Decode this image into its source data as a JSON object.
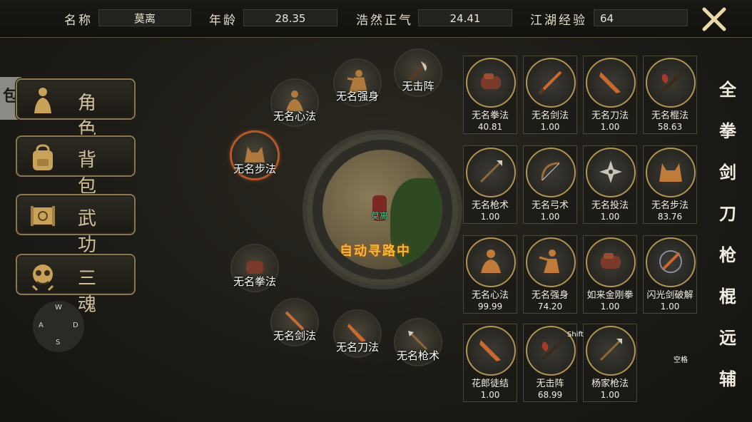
{
  "header": {
    "name_label": "名称",
    "name_value": "莫离",
    "age_label": "年龄",
    "age_value": "28.35",
    "righteous_label": "浩然正气",
    "righteous_value": "24.41",
    "exp_label": "江湖经验",
    "exp_value": "64"
  },
  "edge_tab": "包",
  "sidebar": [
    {
      "label": "角色",
      "icon": "character-icon"
    },
    {
      "label": "背包",
      "icon": "backpack-icon"
    },
    {
      "label": "武功",
      "icon": "scroll-icon"
    },
    {
      "label": "三魂",
      "icon": "soul-mask-icon"
    }
  ],
  "dpad": {
    "up": "W",
    "left": "A",
    "right": "D",
    "down": "S"
  },
  "orbit": [
    {
      "label": "无名心法"
    },
    {
      "label": "无名强身"
    },
    {
      "label": "无击阵"
    },
    {
      "label": "无名步法"
    },
    {
      "label": "无名拳法"
    },
    {
      "label": "无名剑法"
    },
    {
      "label": "无名刀法"
    },
    {
      "label": "无名枪术"
    }
  ],
  "center": {
    "name": "莫离",
    "status": "自动寻路中"
  },
  "skills": [
    {
      "name": "无名拳法",
      "value": "40.81",
      "icon": "gauntlet-icon"
    },
    {
      "name": "无名剑法",
      "value": "1.00",
      "icon": "sword-icon"
    },
    {
      "name": "无名刀法",
      "value": "1.00",
      "icon": "blade-icon"
    },
    {
      "name": "无名棍法",
      "value": "58.63",
      "icon": "axe-staff-icon"
    },
    {
      "name": "无名枪术",
      "value": "1.00",
      "icon": "spear-icon"
    },
    {
      "name": "无名弓术",
      "value": "1.00",
      "icon": "bow-icon"
    },
    {
      "name": "无名投法",
      "value": "1.00",
      "icon": "shuriken-icon"
    },
    {
      "name": "无名步法",
      "value": "83.76",
      "icon": "wolf-icon"
    },
    {
      "name": "无名心法",
      "value": "99.99",
      "icon": "meditation-icon"
    },
    {
      "name": "无名强身",
      "value": "74.20",
      "icon": "martial-pose-icon"
    },
    {
      "name": "如来金刚拳",
      "value": "1.00",
      "icon": "gauntlet-icon"
    },
    {
      "name": "闪光剑破解",
      "value": "1.00",
      "icon": "flash-sword-icon"
    },
    {
      "name": "花郎徒结",
      "value": "1.00",
      "icon": "blade-icon"
    },
    {
      "name": "无击阵",
      "value": "68.99",
      "icon": "axe-staff-icon"
    },
    {
      "name": "杨家枪法",
      "value": "1.00",
      "icon": "spear-icon"
    }
  ],
  "hotkeys": {
    "shift": "Shift",
    "space": "空格"
  },
  "filters": [
    "全",
    "拳",
    "剑",
    "刀",
    "枪",
    "棍",
    "远",
    "辅"
  ],
  "colors": {
    "gold": "#b09553",
    "accent_orange": "#e07030",
    "name_green": "#35d08b"
  }
}
